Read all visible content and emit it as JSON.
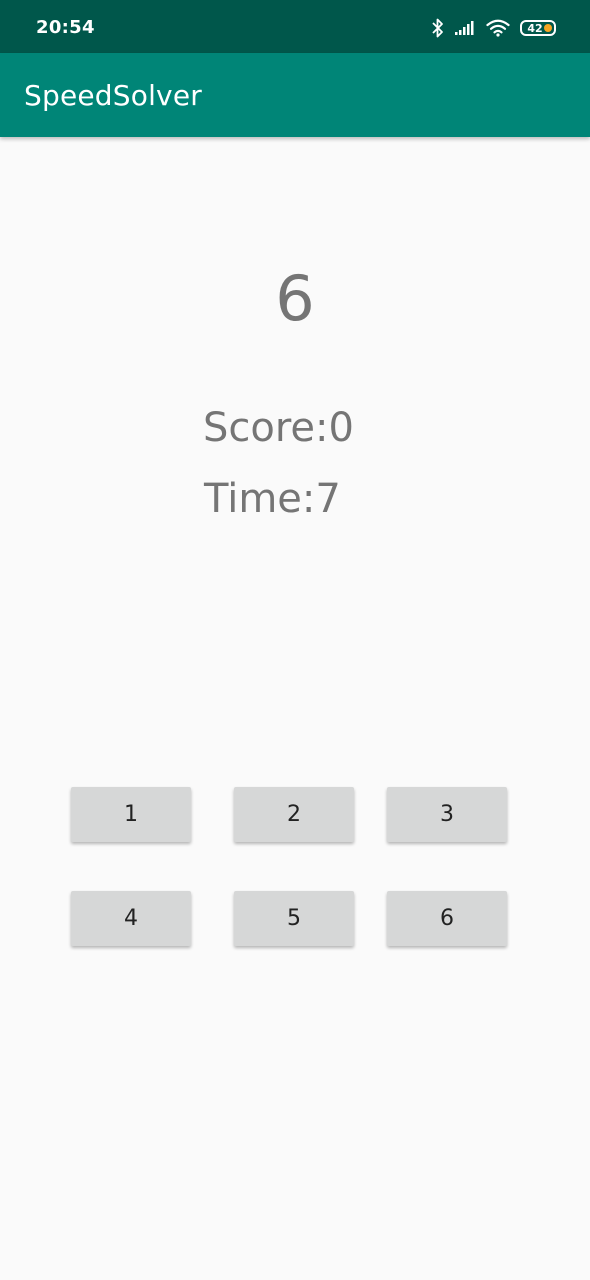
{
  "status_bar": {
    "time": "20:54",
    "battery_level": "42",
    "battery_dot_color": "#f5a623",
    "icons": [
      "bluetooth-icon",
      "signal-icon",
      "wifi-icon",
      "battery-icon"
    ],
    "background": "#00574b"
  },
  "app_bar": {
    "title": "SpeedSolver",
    "background": "#008577"
  },
  "game": {
    "target_number": "6",
    "score_text": "Score:0",
    "time_text": "Time:7"
  },
  "answer_buttons": [
    {
      "label": "1"
    },
    {
      "label": "2"
    },
    {
      "label": "3"
    },
    {
      "label": "4"
    },
    {
      "label": "5"
    },
    {
      "label": "6"
    }
  ]
}
